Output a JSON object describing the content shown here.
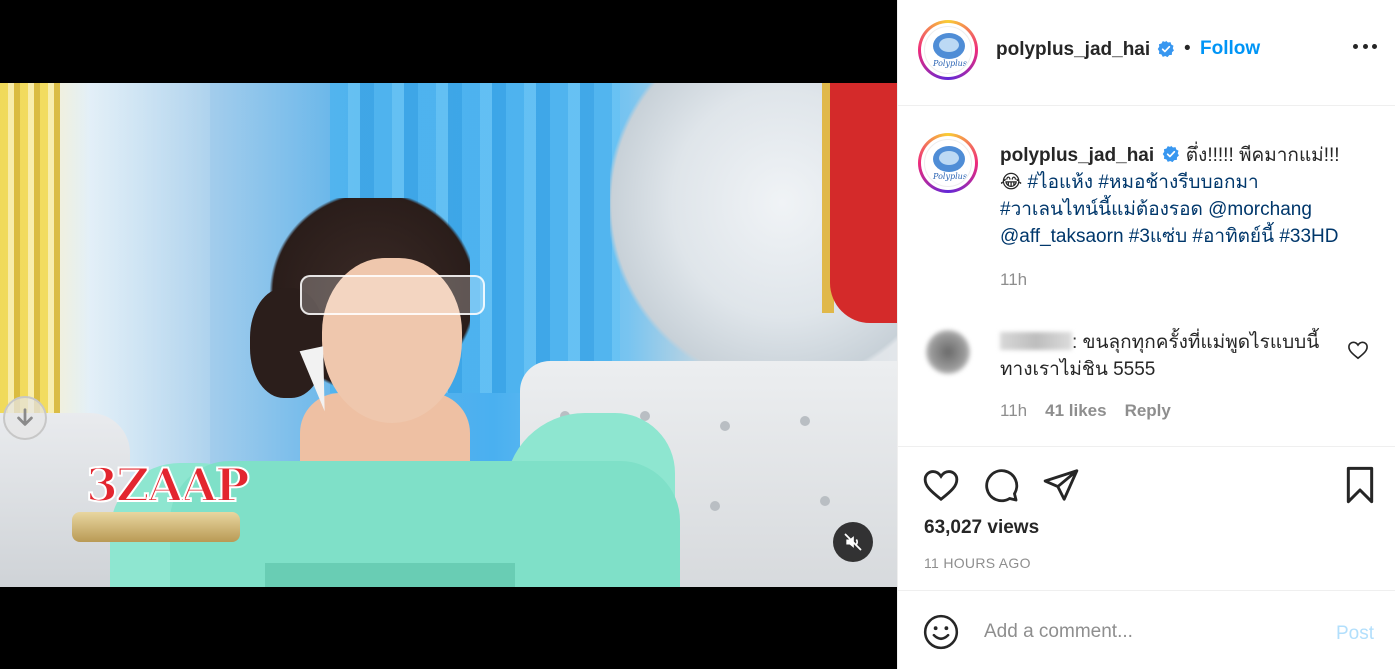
{
  "post": {
    "username": "polyplus_jad_hai",
    "follow_label": "Follow",
    "separator": "•",
    "avatar_brand": "Polyplus"
  },
  "media": {
    "show_logo": "3ZAAP"
  },
  "caption": {
    "username": "polyplus_jad_hai",
    "text_start": "ตึ่ง!!!!! พีคมากแม่!!!",
    "emoji": "😂",
    "tags": [
      "#ไอแห้ง",
      "#หมอช้างรีบบอกมา",
      "#วาเลนไทน์นี้แม่ต้องรอด",
      "@morchang",
      "@aff_taksaorn",
      "#3แซ่บ",
      "#อาทิตย์นี้",
      "#33HD"
    ],
    "time": "11h"
  },
  "comment": {
    "text": ": ขนลุกทุกครั้งที่แม่พูดไรแบบนี้ ทางเราไม่ชิน 5555",
    "time": "11h",
    "likes": "41 likes",
    "reply_label": "Reply"
  },
  "stats": {
    "views": "63,027 views",
    "ago": "11 HOURS AGO"
  },
  "add_comment": {
    "placeholder": "Add a comment...",
    "post_label": "Post"
  },
  "colors": {
    "link": "#0095f6",
    "hashtag": "#00376b",
    "muted": "#8e8e8e",
    "post_disabled": "#b2dffc"
  }
}
